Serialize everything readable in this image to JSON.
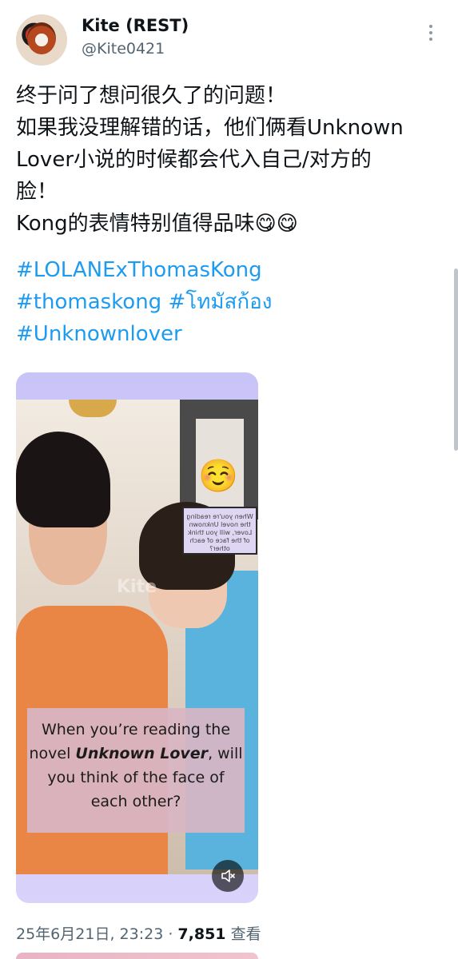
{
  "author": {
    "name": "Kite (REST)",
    "handle": "@Kite0421"
  },
  "tweet": {
    "lines": [
      "终于问了想问很久了的问题！",
      "如果我没理解错的话，他们俩看Unknown",
      "Lover小说的时候都会代入自己/对方的",
      "脸！",
      "Kong的表情特别值得品味😋😋"
    ],
    "hashtags": [
      "#LOLANExThomasKong",
      "#thomaskong #โทมัสก้อง",
      "#Unknownlover"
    ]
  },
  "media": {
    "emoji": "☺️",
    "watermark": "Kite",
    "mirrored_card_text": "When you're reading the novel Unknown Lover, will you think of the face of each other?",
    "caption_before": "When you’re reading the novel ",
    "caption_emphasis": "Unknown Lover",
    "caption_after": ", will you think of the face of each other?"
  },
  "meta": {
    "timestamp": "25年6月21日, 23:23",
    "separator": "·",
    "views": "7,851",
    "views_label": "查看"
  },
  "icons": {
    "more": "more-vertical-icon",
    "mute": "volume-muted-icon"
  },
  "colors": {
    "link": "#1d9bf0",
    "secondary_text": "#536471"
  }
}
